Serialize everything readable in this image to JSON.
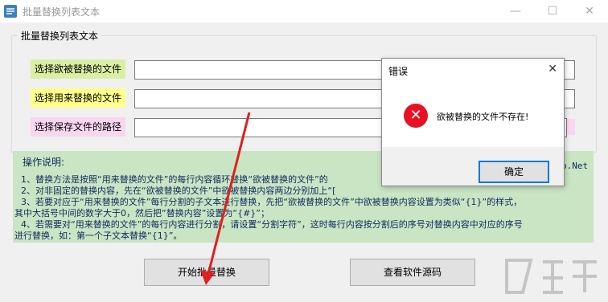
{
  "window": {
    "title": "批量替换列表文本"
  },
  "group": {
    "title": "批量替换列表文本"
  },
  "fields": [
    {
      "label": "选择欲被替换的文件",
      "color": "#d9f0a3"
    },
    {
      "label": "选择用来替换的文件",
      "color": "#ffff8a"
    },
    {
      "label": "选择保存文件的路径",
      "color": "#f9d6f0"
    }
  ],
  "instructions": {
    "title": "操作说明:",
    "lines": [
      "1、替换方法是按照“用来替换的文件”的每行内容循环替换“欲被替换的文件”的",
      "2、对非固定的替换内容，先在“欲被替换的文件”中欲被替换内容两边分别加上“[",
      "3、若要对应于“用来替换的文件”每行分割的子文本进行替换，先把“欲被替换的文件”中欲被替换内容设置为类似“{1}”的样式，",
      "其中大括号中间的数字大于0，然后把“替换内容”设置为“{#}”；",
      "4、若需要对“用来替换的文件”的每行内容进行分割，请设置“分割字符”，这时每行内容按分割后的序号对替换内容中对应的序号",
      "进行替换，如：第一个子文本替换“{1}”。"
    ]
  },
  "buttons": {
    "start": "开始批量替换",
    "view_source": "查看软件源码"
  },
  "watermark": "o.Net",
  "dialog": {
    "title": "错误",
    "message": "欲被替换的文件不存在!",
    "ok": "确定",
    "icon": "error-icon"
  },
  "colors": {
    "error": "#e81123",
    "focus": "#0078d7",
    "instructions_bg": "#c9e5c3"
  }
}
